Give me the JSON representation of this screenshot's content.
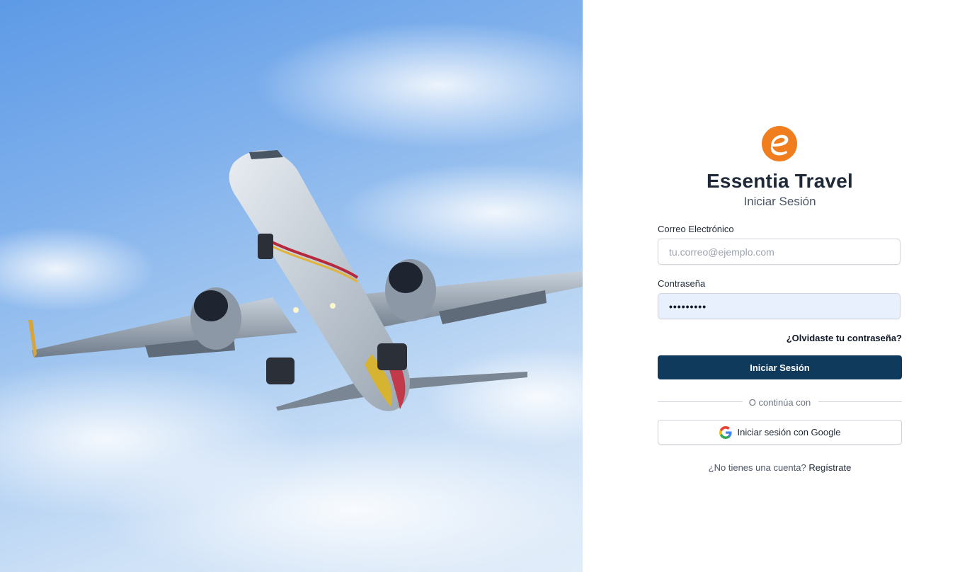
{
  "brand": {
    "name": "Essentia Travel",
    "subtitle": "Iniciar Sesión",
    "logo_icon": "essentia-e-logo",
    "accent_color": "#f07d1e"
  },
  "form": {
    "email_label": "Correo Electrónico",
    "email_placeholder": "tu.correo@ejemplo.com",
    "email_value": "",
    "password_label": "Contraseña",
    "password_value": "•••••••••",
    "forgot_link": "¿Olvidaste tu contraseña?",
    "submit_label": "Iniciar Sesión",
    "submit_color": "#0f3a5c"
  },
  "divider": {
    "text": "O continúa con"
  },
  "google": {
    "label": "Iniciar sesión con Google",
    "icon": "google-icon"
  },
  "signup": {
    "prompt": "¿No tienes una cuenta?",
    "link": "Regístrate"
  },
  "hero": {
    "image": "airplane-taking-off-sky"
  }
}
